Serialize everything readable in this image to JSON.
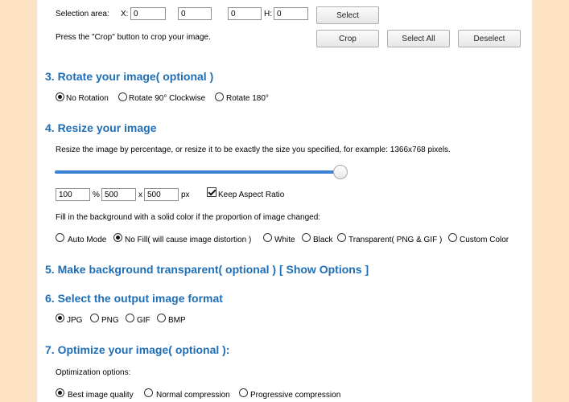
{
  "selection": {
    "label": "Selection area:",
    "x_label": "X:",
    "x_value": "0",
    "y_value": "0",
    "w_value": "0",
    "h_label": "H:",
    "h_value": "0",
    "select_button": "Select",
    "hint": "Press the \"Crop\" button to crop your image.",
    "crop_button": "Crop",
    "select_all_button": "Select All",
    "deselect_button": "Deselect"
  },
  "rotate": {
    "heading": "3. Rotate your image( optional )",
    "options": [
      "No Rotation",
      "Rotate 90° Clockwise",
      "Rotate 180°"
    ],
    "selected": "No Rotation"
  },
  "resize": {
    "heading": "4. Resize your image",
    "description": "Resize the image by percentage, or resize it to be exactly the size you specified, for example: 1366x768 pixels.",
    "slider_level": 1.0,
    "percent_value": "100",
    "percent_unit": "%",
    "width_value": "500",
    "times": "x",
    "height_value": "500",
    "px_unit": "px",
    "keep_aspect_label": "Keep Aspect Ratio",
    "keep_aspect_checked": true,
    "fill_description": "Fill in the background with a solid color if the proportion of image changed:",
    "fill_options": [
      "Auto Mode",
      "No Fill( will cause image distortion )",
      "White",
      "Black",
      "Transparent( PNG & GIF )",
      "Custom Color"
    ],
    "fill_selected": "No Fill( will cause image distortion )"
  },
  "transparent": {
    "heading": "5. Make background transparent( optional )",
    "show_options_link": "[ Show Options ]"
  },
  "format": {
    "heading": "6. Select the output image format",
    "options": [
      "JPG",
      "PNG",
      "GIF",
      "BMP"
    ],
    "selected": "JPG"
  },
  "optimize": {
    "heading": "7. Optimize your image( optional ):",
    "label": "Optimization options:",
    "options": [
      "Best image quality",
      "Normal compression",
      "Progressive compression"
    ],
    "selected": "Best image quality"
  },
  "colors": {
    "heading": "#1f6eb5",
    "slider": "#3b82d4",
    "background": "#fde3c3"
  }
}
